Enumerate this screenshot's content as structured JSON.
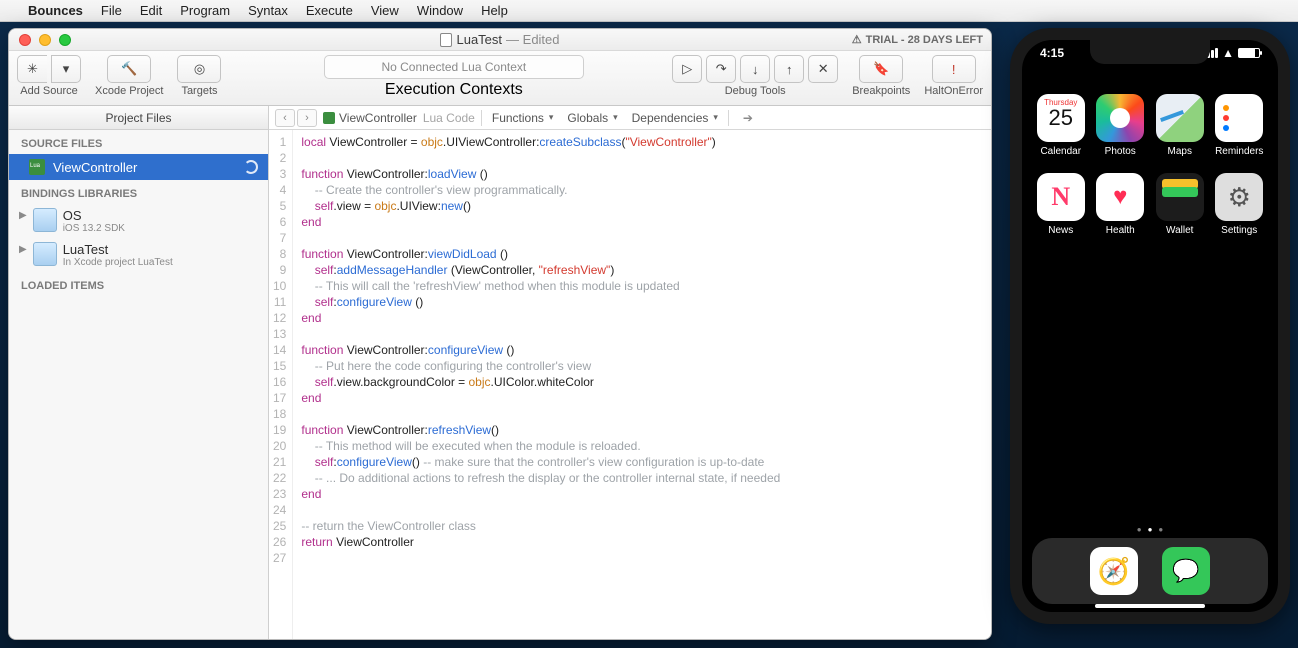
{
  "menubar": {
    "app": "Bounces",
    "items": [
      "File",
      "Edit",
      "Program",
      "Syntax",
      "Execute",
      "View",
      "Window",
      "Help"
    ]
  },
  "window": {
    "title": "LuaTest",
    "subtitle": "— Edited",
    "trial": "TRIAL - 28 DAYS LEFT",
    "toolbar": {
      "addSource": "Add Source",
      "xcodeProject": "Xcode Project",
      "targets": "Targets",
      "execContext": "No Connected Lua Context",
      "execLabel": "Execution Contexts",
      "debugTools": "Debug Tools",
      "breakpoints": "Breakpoints",
      "haltOnError": "HaltOnError"
    },
    "sidebar": {
      "header": "Project Files",
      "sourceFiles": "SOURCE FILES",
      "file": "ViewController",
      "bindings": "BINDINGS LIBRARIES",
      "libs": [
        {
          "name": "OS",
          "sub": "iOS 13.2 SDK"
        },
        {
          "name": "LuaTest",
          "sub": "In Xcode project LuaTest"
        }
      ],
      "loaded": "LOADED ITEMS"
    },
    "pathbar": {
      "file": "ViewController",
      "kind": "Lua Code",
      "functions": "Functions",
      "globals": "Globals",
      "deps": "Dependencies"
    },
    "code": {
      "lines": [
        {
          "n": 1,
          "h": "<span class='kw'>local</span> <span class='id'>ViewController</span> = <span class='obj'>objc</span>.<span class='id'>UIViewController</span>:<span class='fn'>createSubclass</span>(<span class='str'>\"ViewController\"</span>)"
        },
        {
          "n": 2,
          "h": ""
        },
        {
          "n": 3,
          "h": "<span class='kw'>function</span> <span class='id'>ViewController</span>:<span class='fn'>loadView</span> ()"
        },
        {
          "n": 4,
          "h": "    <span class='cm'>-- Create the controller's view programmatically.</span>"
        },
        {
          "n": 5,
          "h": "    <span class='kw'>self</span>.<span class='id'>view</span> = <span class='obj'>objc</span>.<span class='id'>UIView</span>:<span class='fn'>new</span>()"
        },
        {
          "n": 6,
          "h": "<span class='kw'>end</span>"
        },
        {
          "n": 7,
          "h": ""
        },
        {
          "n": 8,
          "h": "<span class='kw'>function</span> <span class='id'>ViewController</span>:<span class='fn'>viewDidLoad</span> ()"
        },
        {
          "n": 9,
          "h": "    <span class='kw'>self</span>:<span class='fn'>addMessageHandler</span> (<span class='id'>ViewController</span>, <span class='str'>\"refreshView\"</span>)"
        },
        {
          "n": 10,
          "h": "    <span class='cm'>-- This will call the 'refreshView' method when this module is updated</span>"
        },
        {
          "n": 11,
          "h": "    <span class='kw'>self</span>:<span class='fn'>configureView</span> ()"
        },
        {
          "n": 12,
          "h": "<span class='kw'>end</span>"
        },
        {
          "n": 13,
          "h": ""
        },
        {
          "n": 14,
          "h": "<span class='kw'>function</span> <span class='id'>ViewController</span>:<span class='fn'>configureView</span> ()"
        },
        {
          "n": 15,
          "h": "    <span class='cm'>-- Put here the code configuring the controller's view</span>"
        },
        {
          "n": 16,
          "h": "    <span class='kw'>self</span>.<span class='id'>view</span>.<span class='id'>backgroundColor</span> = <span class='obj'>objc</span>.<span class='id'>UIColor</span>.<span class='id'>whiteColor</span>"
        },
        {
          "n": 17,
          "h": "<span class='kw'>end</span>"
        },
        {
          "n": 18,
          "h": ""
        },
        {
          "n": 19,
          "h": "<span class='kw'>function</span> <span class='id'>ViewController</span>:<span class='fn'>refreshView</span>()"
        },
        {
          "n": 20,
          "h": "    <span class='cm'>-- This method will be executed when the module is reloaded.</span>"
        },
        {
          "n": 21,
          "h": "    <span class='kw'>self</span>:<span class='fn'>configureView</span>() <span class='cm'>-- make sure that the controller's view configuration is up-to-date</span>"
        },
        {
          "n": 22,
          "h": "    <span class='cm'>-- ... Do additional actions to refresh the display or the controller internal state, if needed</span>"
        },
        {
          "n": 23,
          "h": "<span class='kw'>end</span>"
        },
        {
          "n": 24,
          "h": ""
        },
        {
          "n": 25,
          "h": "<span class='cm'>-- return the ViewController class</span>"
        },
        {
          "n": 26,
          "h": "<span class='kw'>return</span> <span class='id'>ViewController</span>"
        },
        {
          "n": 27,
          "h": ""
        }
      ]
    }
  },
  "sim": {
    "time": "4:15",
    "calendar": {
      "dow": "Thursday",
      "day": "25"
    },
    "apps": [
      {
        "label": "Calendar",
        "cls": "calendar"
      },
      {
        "label": "Photos",
        "cls": "photos"
      },
      {
        "label": "Maps",
        "cls": "maps"
      },
      {
        "label": "Reminders",
        "cls": "reminders"
      },
      {
        "label": "News",
        "cls": "news"
      },
      {
        "label": "Health",
        "cls": "health"
      },
      {
        "label": "Wallet",
        "cls": "wallet"
      },
      {
        "label": "Settings",
        "cls": "settings"
      }
    ],
    "dock": [
      {
        "cls": "safari"
      },
      {
        "cls": "messages"
      }
    ]
  }
}
